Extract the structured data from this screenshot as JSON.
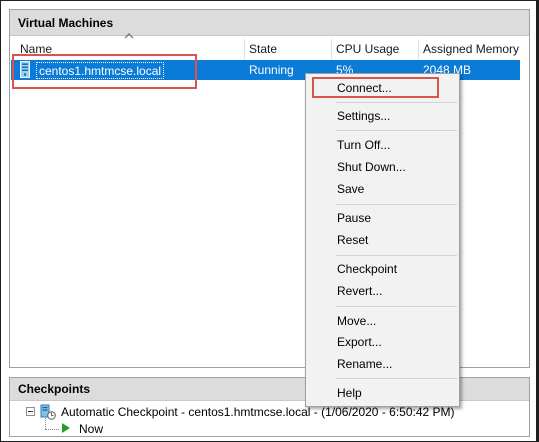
{
  "vm_panel": {
    "title": "Virtual Machines",
    "columns": [
      "Name",
      "State",
      "CPU Usage",
      "Assigned Memory"
    ],
    "rows": [
      {
        "name": "centos1.hmtmcse.local",
        "state": "Running",
        "cpu": "5%",
        "memory": "2048 MB"
      }
    ]
  },
  "context_menu": {
    "items": [
      "Connect...",
      "Settings...",
      "Turn Off...",
      "Shut Down...",
      "Save",
      "Pause",
      "Reset",
      "Checkpoint",
      "Revert...",
      "Move...",
      "Export...",
      "Rename...",
      "Help"
    ]
  },
  "checkpoints": {
    "title": "Checkpoints",
    "tree": {
      "checkpoint_label": "Automatic Checkpoint - centos1.hmtmcse.local - (1/06/2020 - 6:50:42 PM)",
      "now_label": "Now"
    }
  },
  "colors": {
    "selection": "#0a7bd7",
    "highlight_box": "#d9534f",
    "panel_header": "#dcdcdc",
    "menu_bg": "#f2f2f2",
    "now_arrow": "#22a022"
  },
  "icons": {
    "vm": "server-icon",
    "sort": "chevron-up-icon",
    "checkpoint": "checkpoint-icon",
    "now": "play-arrow-icon"
  }
}
